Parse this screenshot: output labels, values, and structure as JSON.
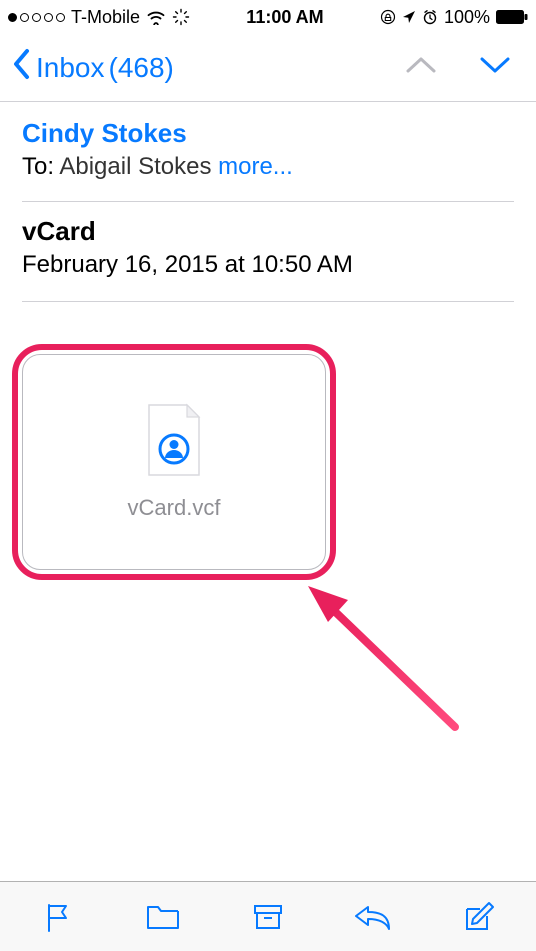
{
  "status": {
    "carrier": "T-Mobile",
    "time": "11:00 AM",
    "battery": "100%"
  },
  "nav": {
    "back_folder": "Inbox",
    "unread_count": "(468)"
  },
  "message": {
    "sender": "Cindy Stokes",
    "to_label": "To:",
    "recipient": "Abigail Stokes",
    "more": "more...",
    "subject": "vCard",
    "date": "February 16, 2015 at 10:50 AM",
    "attachment_name": "vCard.vcf"
  }
}
